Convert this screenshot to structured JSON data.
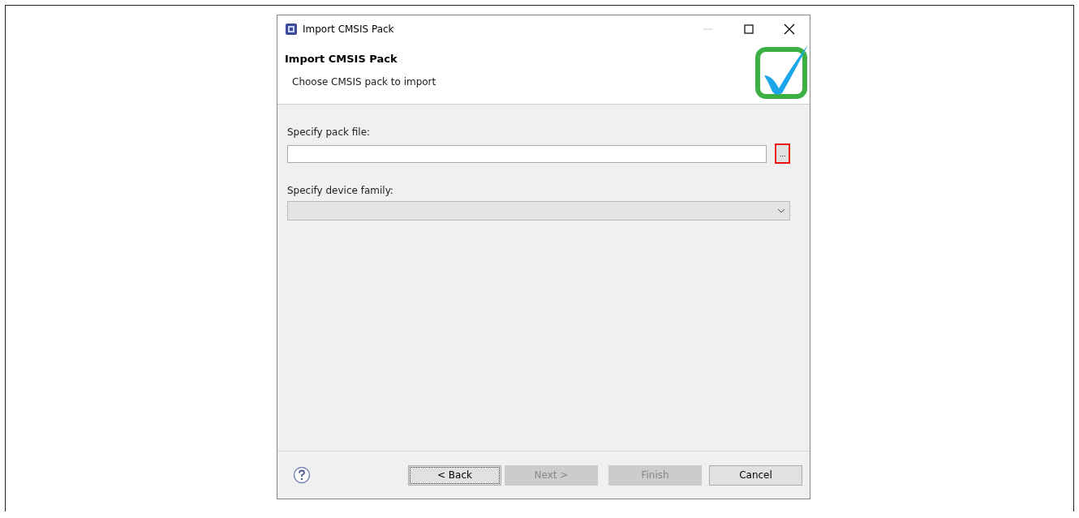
{
  "window": {
    "title": "Import CMSIS Pack",
    "controls": [
      {
        "kind": "minimize",
        "disabled": true
      },
      {
        "kind": "maximize",
        "disabled": false
      },
      {
        "kind": "close",
        "disabled": false
      }
    ]
  },
  "header": {
    "title": "Import CMSIS Pack",
    "subtitle": "Choose CMSIS pack to import"
  },
  "pack_file": {
    "label": "Specify pack file:",
    "browse": "...",
    "browse_highlighted": true
  },
  "device_family": {
    "label": "Specify device family:",
    "disabled": true
  },
  "buttons": [
    {
      "label": "< Back",
      "disabled": false,
      "focused": true
    },
    {
      "label": "Next >",
      "disabled": true,
      "focused": false
    },
    {
      "label": "Finish",
      "disabled": true,
      "focused": false
    },
    {
      "label": "Cancel",
      "disabled": false,
      "focused": false
    }
  ]
}
